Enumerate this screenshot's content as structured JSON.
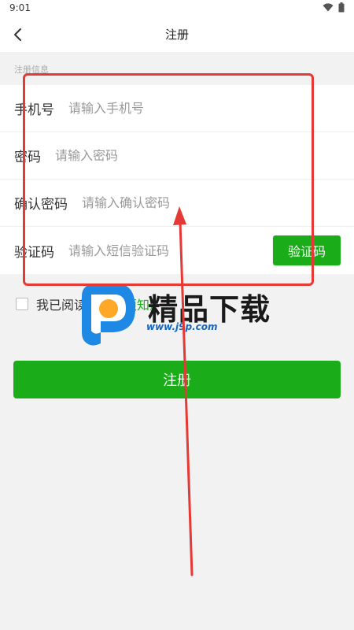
{
  "status": {
    "time": "9:01",
    "wifi_icon": "wifi-icon",
    "battery_icon": "battery-icon"
  },
  "toolbar": {
    "title": "注册",
    "back_icon": "chevron-left-icon"
  },
  "section": {
    "label": "注册信息"
  },
  "form": {
    "phone": {
      "label": "手机号",
      "placeholder": "请输入手机号"
    },
    "password": {
      "label": "密码",
      "placeholder": "请输入密码"
    },
    "confirm": {
      "label": "确认密码",
      "placeholder": "请输入确认密码"
    },
    "code": {
      "label": "验证码",
      "placeholder": "请输入短信验证码",
      "button": "验证码"
    }
  },
  "agreement": {
    "text": "我已阅读",
    "link": "《用户须知》",
    "checked": false
  },
  "submit": {
    "label": "注册"
  },
  "watermark": {
    "brand": "精品下载",
    "url": "www.j9p.com"
  },
  "colors": {
    "accent": "#1aad19",
    "annotation": "#e53935",
    "background": "#f2f2f2",
    "link_blue": "#1565c0"
  }
}
